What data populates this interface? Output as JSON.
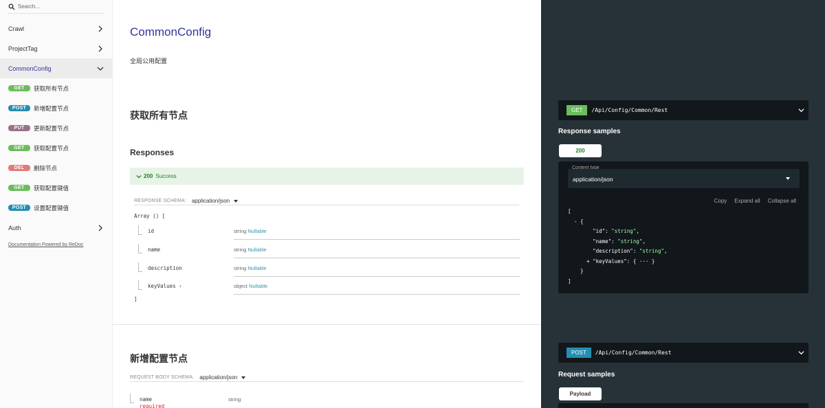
{
  "sidebar": {
    "search_placeholder": "Search...",
    "groups_top": [
      {
        "label": "Crawl"
      },
      {
        "label": "ProjectTag"
      }
    ],
    "active_group": {
      "label": "CommonConfig"
    },
    "operations": [
      {
        "method": "GET",
        "label": "获取所有节点"
      },
      {
        "method": "POST",
        "label": "新增配置节点"
      },
      {
        "method": "PUT",
        "label": "更新配置节点"
      },
      {
        "method": "GET",
        "label": "获取配置节点"
      },
      {
        "method": "DEL",
        "label": "删除节点"
      },
      {
        "method": "GET",
        "label": "获取配置键值"
      },
      {
        "method": "POST",
        "label": "设置配置键值"
      }
    ],
    "groups_bottom": [
      {
        "label": "Auth"
      }
    ],
    "powered_by": "Documentation Powered by ReDoc"
  },
  "main": {
    "title": "CommonConfig",
    "description": "全局公用配置",
    "op1": {
      "title": "获取所有节点",
      "responses_title": "Responses",
      "response_code": "200",
      "response_label": "Success",
      "schema_label": "RESPONSE SCHEMA:",
      "schema_type": "application/json",
      "array_open": "Array () [",
      "array_close": "]",
      "props": [
        {
          "name": "id",
          "type": "string",
          "nullable": "Nullable"
        },
        {
          "name": "name",
          "type": "string",
          "nullable": "Nullable"
        },
        {
          "name": "description",
          "type": "string",
          "nullable": "Nullable"
        },
        {
          "name": "keyValues ›",
          "type": "object",
          "nullable": "Nullable"
        }
      ]
    },
    "op2": {
      "title": "新增配置节点",
      "schema_label": "REQUEST BODY SCHEMA:",
      "schema_type": "application/json",
      "prop": {
        "name": "name",
        "required": "required",
        "type": "string"
      }
    }
  },
  "right": {
    "ep1": {
      "method": "GET",
      "path": "/Api/Config/Common/Rest"
    },
    "response_samples_title": "Response samples",
    "tab_200": "200",
    "content_type_label": "Content type",
    "content_type_value": "application/json",
    "tools": {
      "copy": "Copy",
      "expand": "Expand all",
      "collapse": "Collapse all"
    },
    "code_lines": [
      "[",
      "  - {",
      "        \"id\": \"string\",",
      "        \"name\": \"string\",",
      "        \"description\": \"string\",",
      "      + \"keyValues\": { ··· }",
      "    }",
      "]"
    ],
    "ep2": {
      "method": "POST",
      "path": "/Api/Config/Common/Rest"
    },
    "request_samples_title": "Request samples",
    "tab_payload": "Payload"
  },
  "colors": {
    "accent": "#32329f",
    "get": "#6bbd5b",
    "post": "#248fb2",
    "put": "#9b708b",
    "delete": "#e27a7a",
    "success": "#1d8127",
    "right_bg": "#263238"
  }
}
